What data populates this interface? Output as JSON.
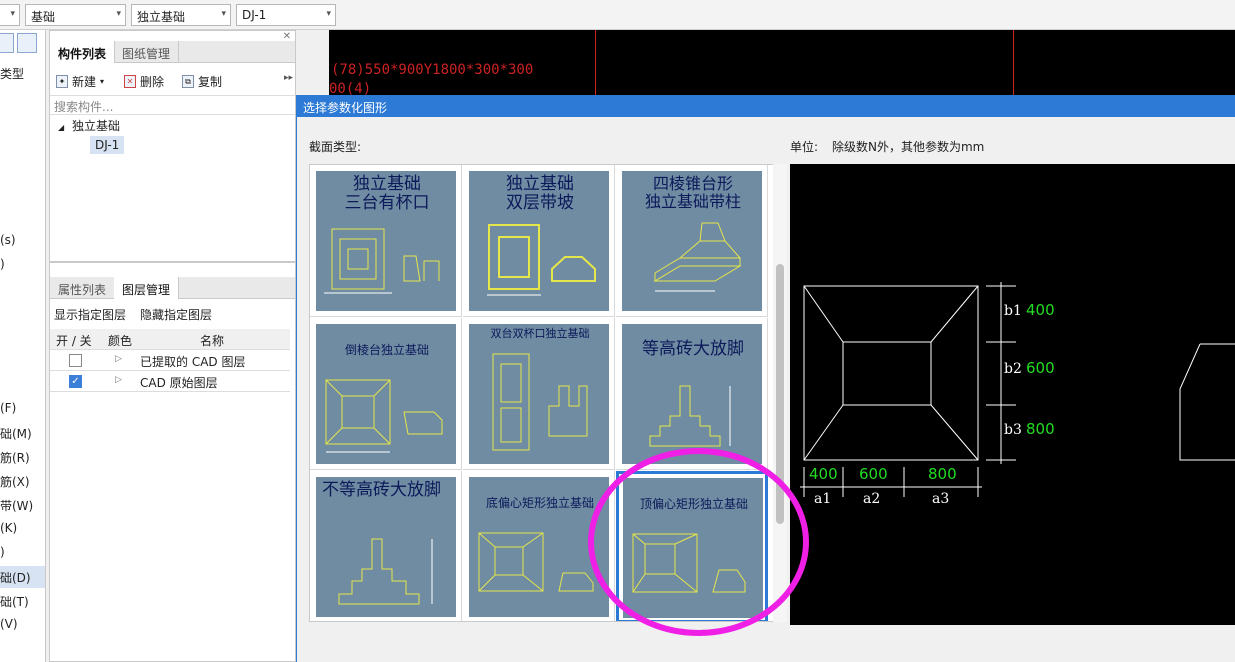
{
  "toolbar": {
    "combo_category": "基础",
    "combo_type": "独立基础",
    "combo_item": "DJ-1"
  },
  "left_strip": {
    "items": [
      "类型",
      "(s)",
      ")",
      "(F)",
      "础(M)",
      "筋(R)",
      "筋(X)",
      "带(W)",
      "(K)",
      ")",
      "础(D)",
      "础(T)",
      "(V)"
    ],
    "selected_index": 10
  },
  "component_panel": {
    "tab_list": "构件列表",
    "tab_drawings": "图纸管理",
    "new_label": "新建",
    "delete_label": "删除",
    "copy_label": "复制",
    "search_placeholder": "搜索构件...",
    "tree_root": "独立基础",
    "tree_child": "DJ-1"
  },
  "layer_panel": {
    "tab_props": "属性列表",
    "tab_layers": "图层管理",
    "show_layer": "显示指定图层",
    "hide_layer": "隐藏指定图层",
    "col_onoff": "开 / 关",
    "col_color": "颜色",
    "col_name": "名称",
    "rows": [
      {
        "checked": false,
        "name": "已提取的 CAD 图层"
      },
      {
        "checked": true,
        "name": "CAD 原始图层"
      }
    ]
  },
  "cad": {
    "text_line1": "(78)550*900Y1800*300*300",
    "text_line2": "00(4)"
  },
  "dialog": {
    "title": "选择参数化图形",
    "section_label": "截面类型:",
    "unit_label": "单位:",
    "unit_text": "除级数N外，其他参数为mm",
    "shapes": [
      {
        "title": "独立基础\n三台有杯口"
      },
      {
        "title": "独立基础\n双层带坡"
      },
      {
        "title": "四棱锥台形\n独立基础带柱"
      },
      {
        "title": "倒棱台独立基础"
      },
      {
        "title": "双台双杯口独立基础"
      },
      {
        "title": "等高砖大放脚"
      },
      {
        "title": "不等高砖大放脚"
      },
      {
        "title": "底偏心矩形独立基础"
      },
      {
        "title": "顶偏心矩形独立基础"
      }
    ],
    "selected_shape": 8,
    "preview": {
      "b1": "b1",
      "b2": "b2",
      "b3": "b3",
      "v_b1": "400",
      "v_b2": "600",
      "v_b3": "800",
      "a1": "a1",
      "a2": "a2",
      "a3": "a3",
      "v_a1": "400",
      "v_a2": "600",
      "v_a3": "800"
    }
  },
  "colors": {
    "accent": "#2d7ad6",
    "highlight_circle": "#ef1fe6",
    "cad_green": "#22dd22",
    "cad_red": "#cc2222",
    "thumb_bg": "#6f8ca3"
  }
}
